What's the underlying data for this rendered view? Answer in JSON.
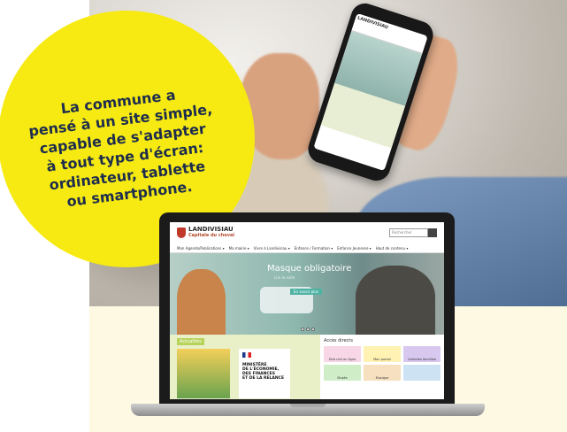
{
  "bubble": {
    "lines": [
      "La commune a",
      "pensé à un site simple,",
      "capable de s'adapter",
      "à tout type d'écran:",
      "ordinateur, tablette",
      "ou smartphone."
    ]
  },
  "phone": {
    "brand": "LANDIVISIAU"
  },
  "site": {
    "brand": "LANDIVISIAU",
    "tagline": "Capitale du cheval",
    "search_placeholder": "Rechercher",
    "nav": [
      "Mon Agenda/Publications ▾",
      "Ma mairie ▾",
      "Vivre à Landivisiau ▾",
      "Enfance / Formation ▾",
      "Enfance Jeunesse ▾",
      "Haut de contenu ▾"
    ],
    "hero": {
      "title": "Masque obligatoire",
      "subtitle": "Lire la suite",
      "button": "En savoir plus"
    },
    "news": {
      "tag": "Actualités",
      "ministry": [
        "MINISTÈRE",
        "DE L'ÉCONOMIE,",
        "DES FINANCES",
        "ET DE LA RELANCE"
      ]
    },
    "quick_access": {
      "title": "Accès directs",
      "tiles": [
        {
          "label": "Etat civil en ligne",
          "color": "#f7d7e6"
        },
        {
          "label": "Mon portail",
          "color": "#fff2b3"
        },
        {
          "label": "Collectes familiale",
          "color": "#d8c8f0"
        },
        {
          "label": "Musée",
          "color": "#cfeec7"
        },
        {
          "label": "Musique",
          "color": "#f7e0c0"
        },
        {
          "label": "",
          "color": "#cde3f4"
        }
      ]
    }
  },
  "colors": {
    "bubble": "#f6ea12",
    "bubble_text": "#1e2d4d",
    "cream": "#fdf9e2"
  }
}
